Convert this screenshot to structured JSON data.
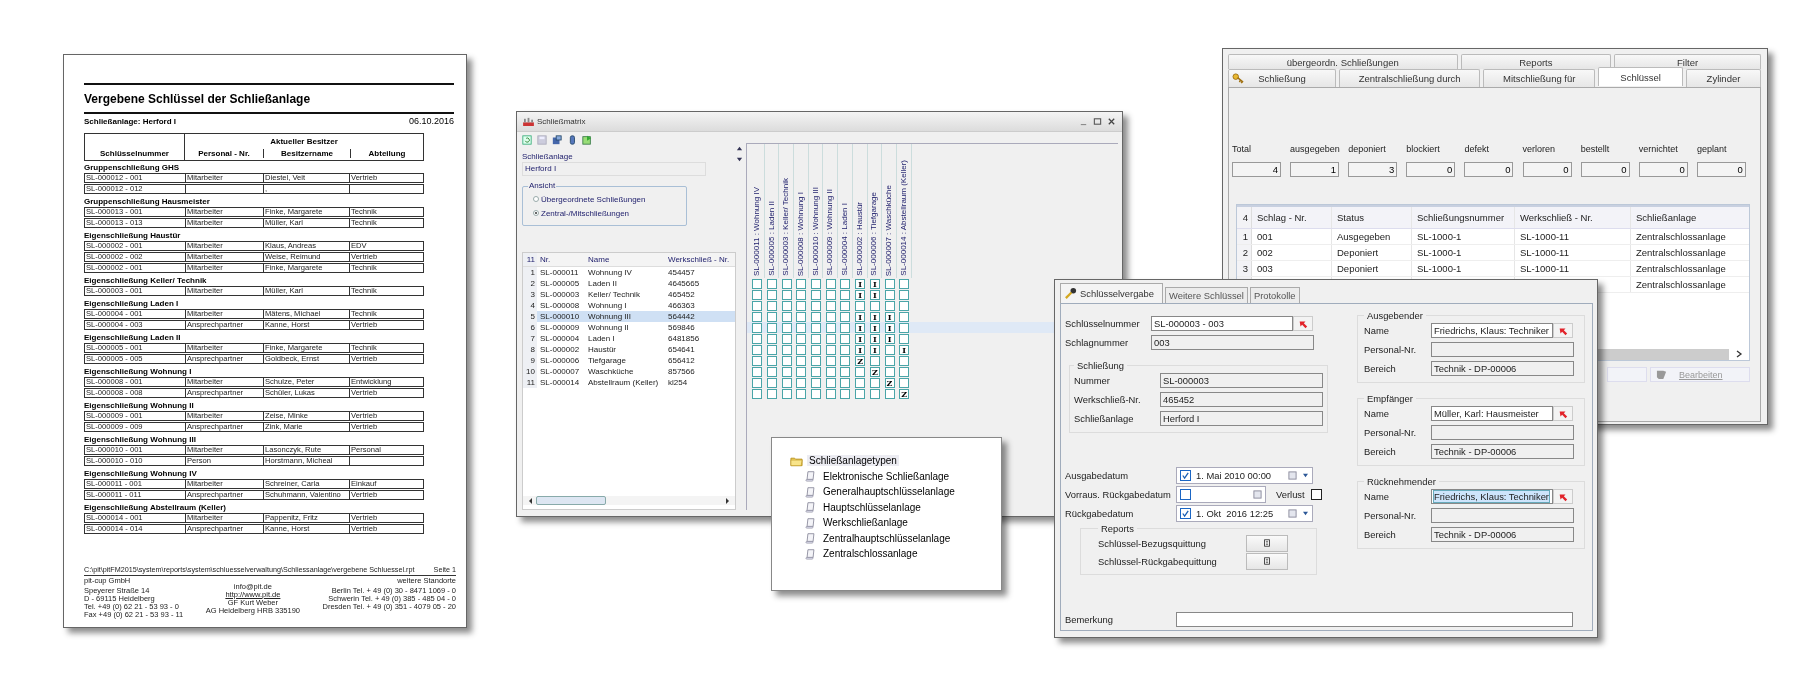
{
  "report": {
    "title": "Vergebene Schlüssel der Schließanlage",
    "subtitle": "Schließanlage: Herford I",
    "date": "06.10.2016",
    "header_group": "Aktueller Besitzer",
    "columns": [
      "Schlüsselnummer",
      "Personal - Nr.",
      "Besitzername",
      "Abteilung"
    ],
    "groups": [
      {
        "title": "Gruppenschließung GHS",
        "rows": [
          {
            "nr": "SL-000012 - 001",
            "personal": "Mitarbeiter",
            "name": "Diestel, Veit",
            "abteilung": "Vertrieb"
          },
          {
            "nr": "SL-000012 - 012",
            "name": ","
          }
        ]
      },
      {
        "title": "Gruppenschließung Hausmeister",
        "rows": [
          {
            "nr": "SL-000013 - 001",
            "personal": "Mitarbeiter",
            "name": "Finke, Margarete",
            "abteilung": "Technik"
          },
          {
            "nr": "SL-000013 - 013",
            "personal": "Mitarbeiter",
            "name": "Müller, Karl",
            "abteilung": "Technik"
          }
        ]
      },
      {
        "title": "Eigenschließung Haustür",
        "rows": [
          {
            "nr": "SL-000002 - 001",
            "personal": "Mitarbeiter",
            "name": "Klaus, Andreas",
            "abteilung": "EDV"
          },
          {
            "nr": "SL-000002 - 002",
            "personal": "Mitarbeiter",
            "name": "Weise, Reimund",
            "abteilung": "Vertrieb"
          },
          {
            "nr": "SL-000002 - 001",
            "personal": "Mitarbeiter",
            "name": "Finke, Margarete",
            "abteilung": "Technik"
          }
        ]
      },
      {
        "title": "Eigenschließung Keller/ Technik",
        "rows": [
          {
            "nr": "SL-000003 - 001",
            "personal": "Mitarbeiter",
            "name": "Müller, Karl",
            "abteilung": "Technik"
          }
        ]
      },
      {
        "title": "Eigenschließung Laden I",
        "rows": [
          {
            "nr": "SL-000004 - 001",
            "personal": "Mitarbeiter",
            "name": "Mätens, Michael",
            "abteilung": "Technik"
          },
          {
            "nr": "SL-000004 - 003",
            "personal": "Ansprechpartner",
            "name": "Kanne, Horst",
            "abteilung": "Vertrieb"
          }
        ]
      },
      {
        "title": "Eigenschließung Laden II",
        "rows": [
          {
            "nr": "SL-000005 - 001",
            "personal": "Mitarbeiter",
            "name": "Finke, Margarete",
            "abteilung": "Technik"
          },
          {
            "nr": "SL-000005 - 005",
            "personal": "Ansprechpartner",
            "name": "Goldbeck, Ernst",
            "abteilung": "Vertrieb"
          }
        ]
      },
      {
        "title": "Eigenschließung Wohnung I",
        "rows": [
          {
            "nr": "SL-000008 - 001",
            "personal": "Mitarbeiter",
            "name": "Schulze, Peter",
            "abteilung": "Entwicklung"
          },
          {
            "nr": "SL-000008 - 008",
            "personal": "Ansprechpartner",
            "name": "Schüler, Lukas",
            "abteilung": "Vertrieb"
          }
        ]
      },
      {
        "title": "Eigenschließung Wohnung II",
        "rows": [
          {
            "nr": "SL-000009 - 001",
            "personal": "Mitarbeiter",
            "name": "Zeise, Minke",
            "abteilung": "Vertrieb"
          },
          {
            "nr": "SL-000009 - 009",
            "personal": "Ansprechpartner",
            "name": "Zink, Marie",
            "abteilung": "Vertrieb"
          }
        ]
      },
      {
        "title": "Eigenschließung Wohnung III",
        "rows": [
          {
            "nr": "SL-000010 - 001",
            "personal": "Mitarbeiter",
            "name": "Lasonczyk, Rute",
            "abteilung": "Personal"
          },
          {
            "nr": "SL-000010 - 010",
            "personal": "Person",
            "name": "Horstmann, Micheal"
          }
        ]
      },
      {
        "title": "Eigenschließung Wohnung IV",
        "rows": [
          {
            "nr": "SL-000011 - 001",
            "personal": "Mitarbeiter",
            "name": "Schreiner, Carla",
            "abteilung": "Einkauf"
          },
          {
            "nr": "SL-000011 - 011",
            "personal": "Ansprechpartner",
            "name": "Schuhmann, Valentino",
            "abteilung": "Vertrieb"
          }
        ]
      },
      {
        "title": "Eigenschließung Abstellraum (Keller)",
        "rows": [
          {
            "nr": "SL-000014 - 001",
            "personal": "Mitarbeiter",
            "name": "Pappenitz, Fritz",
            "abteilung": "Vertrieb"
          },
          {
            "nr": "SL-000014 - 014",
            "personal": "Ansprechpartner",
            "name": "Kanne, Horst",
            "abteilung": "Vertrieb"
          }
        ]
      }
    ],
    "footer": {
      "path": "C:\\pit\\pitFM2015\\system\\reports\\system\\schluesselverwaltung\\Schliessanlage\\vergebene Schluessel.rpt",
      "page": "Seite 1",
      "left": [
        "pit-cup GmbH",
        "Speyerer Straße 14",
        "D - 69115 Heidelberg",
        "Tel. +49 (0) 62 21 - 53 93 - 0",
        "Fax +49 (0) 62 21 - 53 93 - 11"
      ],
      "center": [
        {
          "text": "info@pit.de",
          "kind": "text"
        },
        {
          "text": "http://www.pit.de",
          "kind": "link"
        },
        {
          "text": "GF Kurt Weber",
          "kind": "text"
        },
        {
          "text": "AG Heidelberg HRB 335190",
          "kind": "text"
        }
      ],
      "right": [
        "weitere Standorte",
        "Berlin Tel. + 49 (0) 30 - 8471 1069 - 0",
        "Schwerin Tel. + 49 (0) 385 - 485 04 - 0",
        "Dresden Tel. + 49 (0) 351 - 4079 05 - 20"
      ]
    }
  },
  "matrix_window": {
    "title": "Schließmatrix",
    "anlage_label": "Schließanlage",
    "anlage_value": "Herford I",
    "view_group": "Ansicht",
    "view_options": [
      {
        "label": "Übergeordnete Schließungen",
        "selected": false
      },
      {
        "label": "Zentral-/Mitschließungen",
        "selected": true
      }
    ],
    "row_count": "11",
    "columns": [
      "Nr.",
      "Name",
      "Werkschließ - Nr."
    ],
    "matrix_columns": [
      "SL-000011 : Wohnung IV",
      "SL-000005 : Laden II",
      "SL-000003 : Keller/ Technik",
      "SL-000008 : Wohnung I",
      "SL-000010 : Wohnung III",
      "SL-000009 : Wohnung II",
      "SL-000004 : Laden I",
      "SL-000002 : Haustür",
      "SL-000006 : Tiefgarage",
      "SL-000007 : Waschküche",
      "SL-000014 : Abstellraum (Keller)"
    ],
    "rows": [
      {
        "index": "1",
        "nr": "SL-000011",
        "name": "Wohnung IV",
        "werk": "454457",
        "selected": false,
        "marks": [
          {
            "kind": "blank"
          },
          {
            "kind": "blank"
          },
          {
            "kind": "blank"
          },
          {
            "kind": "blank"
          },
          {
            "kind": "blank"
          },
          {
            "kind": "blank"
          },
          {
            "kind": "blank"
          },
          {
            "kind": "mark",
            "text": "I"
          },
          {
            "kind": "mark",
            "text": "I"
          },
          {
            "kind": "blank"
          },
          {
            "kind": "blank"
          }
        ]
      },
      {
        "index": "2",
        "nr": "SL-000005",
        "name": "Laden II",
        "werk": "4645665",
        "selected": false,
        "marks": [
          {
            "kind": "blank"
          },
          {
            "kind": "blank"
          },
          {
            "kind": "blank"
          },
          {
            "kind": "blank"
          },
          {
            "kind": "blank"
          },
          {
            "kind": "blank"
          },
          {
            "kind": "blank"
          },
          {
            "kind": "mark",
            "text": "I"
          },
          {
            "kind": "mark",
            "text": "I"
          },
          {
            "kind": "blank"
          },
          {
            "kind": "blank"
          }
        ]
      },
      {
        "index": "3",
        "nr": "SL-000003",
        "name": "Keller/ Technik",
        "werk": "465452",
        "selected": false,
        "marks": [
          {
            "kind": "blank"
          },
          {
            "kind": "blank"
          },
          {
            "kind": "blank"
          },
          {
            "kind": "blank"
          },
          {
            "kind": "blank"
          },
          {
            "kind": "blank"
          },
          {
            "kind": "blank"
          },
          {
            "kind": "blank"
          },
          {
            "kind": "blank"
          },
          {
            "kind": "blank"
          },
          {
            "kind": "blank"
          }
        ]
      },
      {
        "index": "4",
        "nr": "SL-000008",
        "name": "Wohnung I",
        "werk": "466363",
        "selected": false,
        "marks": [
          {
            "kind": "blank"
          },
          {
            "kind": "blank"
          },
          {
            "kind": "blank"
          },
          {
            "kind": "blank"
          },
          {
            "kind": "blank"
          },
          {
            "kind": "blank"
          },
          {
            "kind": "blank"
          },
          {
            "kind": "mark",
            "text": "I"
          },
          {
            "kind": "mark",
            "text": "I"
          },
          {
            "kind": "mark",
            "text": "I"
          },
          {
            "kind": "blank"
          }
        ]
      },
      {
        "index": "5",
        "nr": "SL-000010",
        "name": "Wohnung III",
        "werk": "564442",
        "selected": true,
        "marks": [
          {
            "kind": "blank"
          },
          {
            "kind": "blank"
          },
          {
            "kind": "blank"
          },
          {
            "kind": "blank"
          },
          {
            "kind": "blank"
          },
          {
            "kind": "blank"
          },
          {
            "kind": "blank"
          },
          {
            "kind": "mark",
            "text": "I"
          },
          {
            "kind": "mark",
            "text": "I"
          },
          {
            "kind": "mark",
            "text": "I"
          },
          {
            "kind": "blank"
          }
        ]
      },
      {
        "index": "6",
        "nr": "SL-000009",
        "name": "Wohnung II",
        "werk": "569846",
        "selected": false,
        "marks": [
          {
            "kind": "blank"
          },
          {
            "kind": "blank"
          },
          {
            "kind": "blank"
          },
          {
            "kind": "blank"
          },
          {
            "kind": "blank"
          },
          {
            "kind": "blank"
          },
          {
            "kind": "blank"
          },
          {
            "kind": "mark",
            "text": "I"
          },
          {
            "kind": "mark",
            "text": "I"
          },
          {
            "kind": "mark",
            "text": "I"
          },
          {
            "kind": "blank"
          }
        ]
      },
      {
        "index": "7",
        "nr": "SL-000004",
        "name": "Laden I",
        "werk": "6481856",
        "selected": false,
        "marks": [
          {
            "kind": "blank"
          },
          {
            "kind": "blank"
          },
          {
            "kind": "blank"
          },
          {
            "kind": "blank"
          },
          {
            "kind": "blank"
          },
          {
            "kind": "blank"
          },
          {
            "kind": "blank"
          },
          {
            "kind": "mark",
            "text": "I"
          },
          {
            "kind": "mark",
            "text": "I"
          },
          {
            "kind": "blank"
          },
          {
            "kind": "mark",
            "text": "I"
          }
        ]
      },
      {
        "index": "8",
        "nr": "SL-000002",
        "name": "Haustür",
        "werk": "654641",
        "selected": false,
        "marks": [
          {
            "kind": "blank"
          },
          {
            "kind": "blank"
          },
          {
            "kind": "blank"
          },
          {
            "kind": "blank"
          },
          {
            "kind": "blank"
          },
          {
            "kind": "blank"
          },
          {
            "kind": "blank"
          },
          {
            "kind": "mark",
            "text": "Z"
          },
          {
            "kind": "blank"
          },
          {
            "kind": "blank"
          },
          {
            "kind": "blank"
          }
        ]
      },
      {
        "index": "9",
        "nr": "SL-000006",
        "name": "Tiefgarage",
        "werk": "656412",
        "selected": false,
        "marks": [
          {
            "kind": "blank"
          },
          {
            "kind": "blank"
          },
          {
            "kind": "blank"
          },
          {
            "kind": "blank"
          },
          {
            "kind": "blank"
          },
          {
            "kind": "blank"
          },
          {
            "kind": "blank"
          },
          {
            "kind": "blank"
          },
          {
            "kind": "mark",
            "text": "Z"
          },
          {
            "kind": "blank"
          },
          {
            "kind": "blank"
          }
        ]
      },
      {
        "index": "10",
        "nr": "SL-000007",
        "name": "Waschküche",
        "werk": "857566",
        "selected": false,
        "marks": [
          {
            "kind": "blank"
          },
          {
            "kind": "blank"
          },
          {
            "kind": "blank"
          },
          {
            "kind": "blank"
          },
          {
            "kind": "blank"
          },
          {
            "kind": "blank"
          },
          {
            "kind": "blank"
          },
          {
            "kind": "blank"
          },
          {
            "kind": "blank"
          },
          {
            "kind": "mark",
            "text": "Z"
          },
          {
            "kind": "blank"
          }
        ]
      },
      {
        "index": "11",
        "nr": "SL-000014",
        "name": "Abstellraum (Keller)",
        "werk": "kl254",
        "selected": false,
        "marks": [
          {
            "kind": "blank"
          },
          {
            "kind": "blank"
          },
          {
            "kind": "blank"
          },
          {
            "kind": "blank"
          },
          {
            "kind": "blank"
          },
          {
            "kind": "blank"
          },
          {
            "kind": "blank"
          },
          {
            "kind": "blank"
          },
          {
            "kind": "blank"
          },
          {
            "kind": "blank"
          },
          {
            "kind": "mark",
            "text": "Z"
          }
        ]
      }
    ]
  },
  "tree": {
    "root": {
      "label": "Schließanlagetypen",
      "selected": true
    },
    "children": [
      {
        "label": "Elektronische Schließanlage",
        "selected": false
      },
      {
        "label": "Generalhauptschlüsselanlage",
        "selected": false
      },
      {
        "label": "Hauptschlüsselanlage",
        "selected": false
      },
      {
        "label": "Werkschließanlage",
        "selected": false
      },
      {
        "label": "Zentralhauptschlüsselanlage",
        "selected": false
      },
      {
        "label": "Zentralschlossanlage",
        "selected": false
      }
    ]
  },
  "key_window": {
    "tab_rows": [
      [
        {
          "label": "übergeordn. Schließungen",
          "selected": false
        },
        {
          "label": "Reports",
          "selected": false
        },
        {
          "label": "Filter",
          "selected": false
        }
      ],
      [
        {
          "label": "Schließung",
          "selected": false
        },
        {
          "label": "Zentralschließung durch",
          "selected": false
        },
        {
          "label": "Mitschließung für",
          "selected": false
        },
        {
          "label": "Schlüssel",
          "selected": true
        },
        {
          "label": "Zylinder",
          "selected": false
        }
      ]
    ],
    "counts": [
      {
        "label": "Total",
        "value": "4"
      },
      {
        "label": "ausgegeben",
        "value": "1"
      },
      {
        "label": "deponiert",
        "value": "3"
      },
      {
        "label": "blockiert",
        "value": "0"
      },
      {
        "label": "defekt",
        "value": "0"
      },
      {
        "label": "verloren",
        "value": "0"
      },
      {
        "label": "bestellt",
        "value": "0"
      },
      {
        "label": "vernichtet",
        "value": "0"
      },
      {
        "label": "geplant",
        "value": "0"
      }
    ],
    "table": {
      "count": "4",
      "columns": [
        "Schlag - Nr.",
        "Status",
        "Schließungsnummer",
        "Werkschließ - Nr.",
        "Schließanlage"
      ],
      "rows": [
        {
          "index": "1",
          "schlag": "001",
          "status": "Ausgegeben",
          "schliessung": "SL-1000-1",
          "werk": "SL-1000-11",
          "anlage": "Zentralschlossanlage"
        },
        {
          "index": "2",
          "schlag": "002",
          "status": "Deponiert",
          "schliessung": "SL-1000-1",
          "werk": "SL-1000-11",
          "anlage": "Zentralschlossanlage"
        },
        {
          "index": "3",
          "schlag": "003",
          "status": "Deponiert",
          "schliessung": "SL-1000-1",
          "werk": "SL-1000-11",
          "anlage": "Zentralschlossanlage"
        },
        {
          "anlage": "Zentralschlossanlage"
        }
      ]
    },
    "edit_button": "Bearbeiten"
  },
  "dialog": {
    "tabs": [
      {
        "label": "Schlüsselvergabe",
        "selected": true
      },
      {
        "label": "Weitere Schlüssel",
        "selected": false
      },
      {
        "label": "Protokolle",
        "selected": false
      }
    ],
    "key_fields": [
      {
        "label": "Schlüsselnummer",
        "value": "SL-000003 - 003",
        "kind": "picker"
      },
      {
        "label": "Schlagnummer",
        "value": "003",
        "kind": "text"
      }
    ],
    "closing": {
      "title": "Schließung",
      "fields": [
        {
          "label": "Nummer",
          "value": "SL-000003"
        },
        {
          "label": "Werkschließ-Nr.",
          "value": "465452"
        },
        {
          "label": "Schließanlage",
          "value": "Herford I"
        }
      ]
    },
    "dates": [
      {
        "label": "Ausgabedatum",
        "checked": true,
        "value": "1. Mai 2010 00:00",
        "kind": "dropdown"
      },
      {
        "label": "Vorraus. Rückgabedatum",
        "checked": false,
        "kind": "plain"
      },
      {
        "label": "Rückgabedatum",
        "checked": true,
        "value": "1. Okt  2016 12:25",
        "kind": "dropdown"
      }
    ],
    "loss": {
      "label": "Verlust",
      "checked": false
    },
    "reports": {
      "title": "Reports",
      "items": [
        "Schlüssel-Bezugsquittung",
        "Schlüssel-Rückgabequittung"
      ]
    },
    "remark_label": "Bemerkung",
    "people": [
      {
        "title": "Ausgebender",
        "fields": [
          {
            "label": "Name",
            "value": "Friedrichs, Klaus: Techniker",
            "kind": "picker",
            "highlighted": false
          },
          {
            "label": "Personal-Nr.",
            "kind": "text"
          },
          {
            "label": "Bereich",
            "value": "Technik - DP-00006",
            "kind": "text"
          }
        ]
      },
      {
        "title": "Empfänger",
        "fields": [
          {
            "label": "Name",
            "value": "Müller, Karl: Hausmeister",
            "kind": "picker",
            "highlighted": false
          },
          {
            "label": "Personal-Nr.",
            "kind": "text"
          },
          {
            "label": "Bereich",
            "value": "Technik - DP-00006",
            "kind": "text"
          }
        ]
      },
      {
        "title": "Rücknehmender",
        "fields": [
          {
            "label": "Name",
            "value": "Friedrichs, Klaus: Techniker",
            "kind": "picker",
            "highlighted": true
          },
          {
            "label": "Personal-Nr.",
            "kind": "text"
          },
          {
            "label": "Bereich",
            "value": "Technik - DP-00006",
            "kind": "text"
          }
        ]
      }
    ]
  }
}
